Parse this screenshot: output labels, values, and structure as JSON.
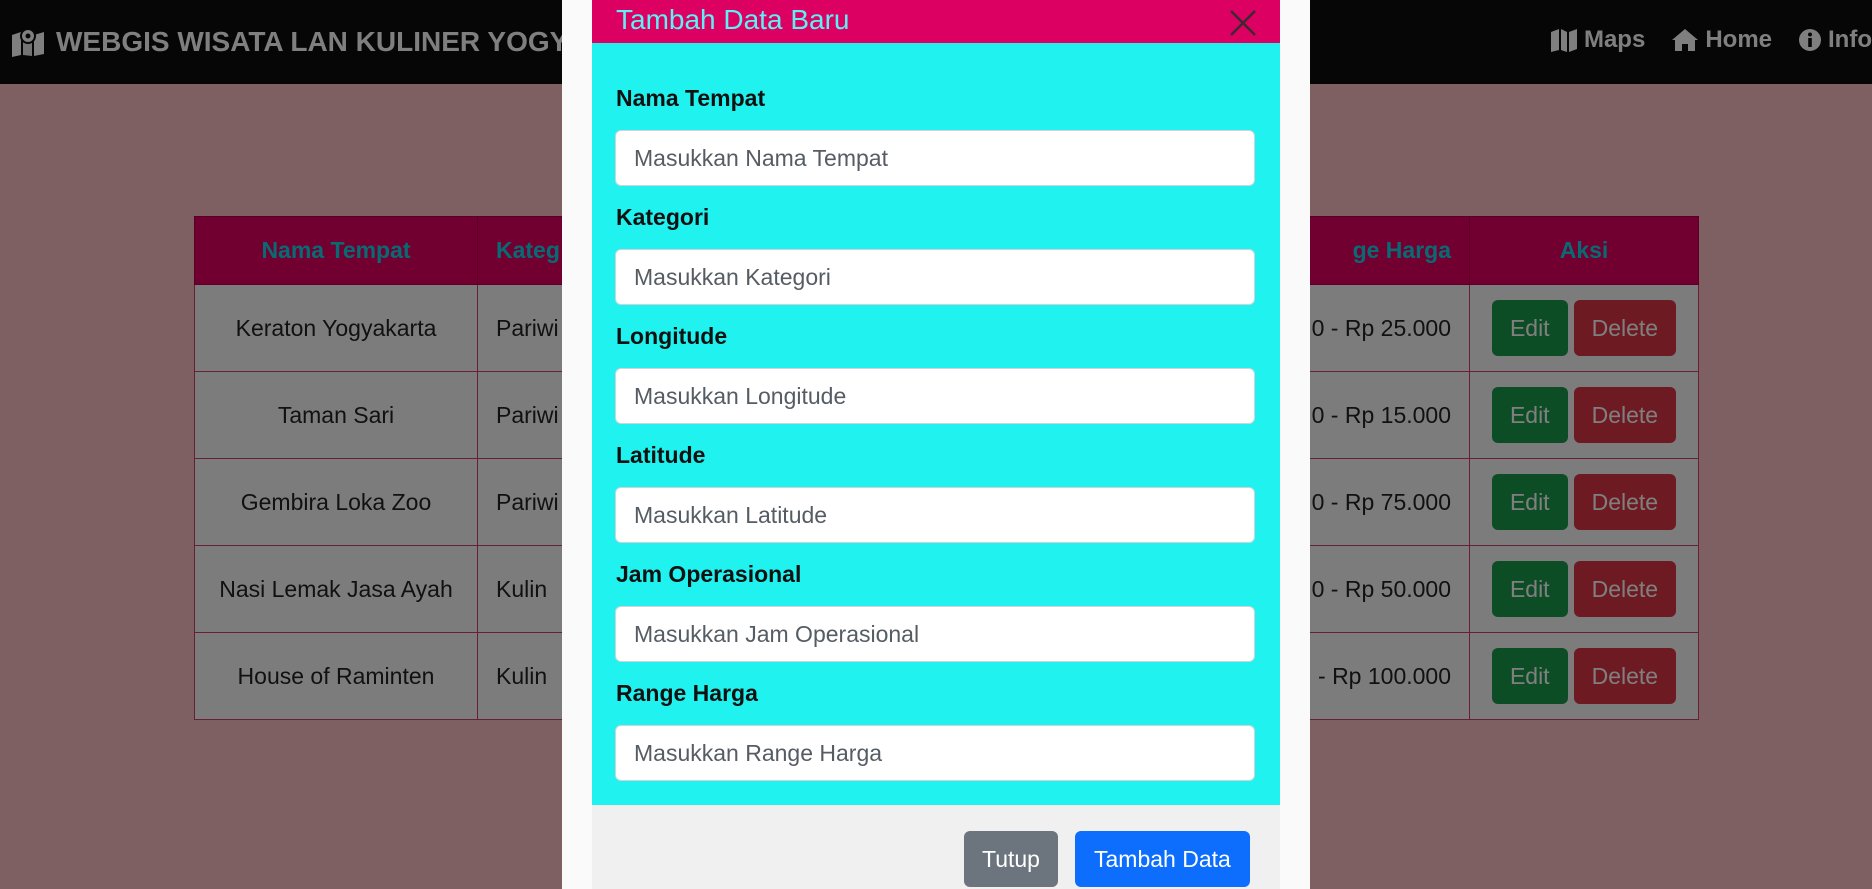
{
  "navbar": {
    "brand_icon": "map-location-icon",
    "brand": "WEBGIS WISATA LAN KULINER YOGYA",
    "links": [
      {
        "label": "Maps",
        "icon": "map-icon"
      },
      {
        "label": "Home",
        "icon": "home-icon"
      },
      {
        "label": "Info",
        "icon": "info-icon"
      }
    ]
  },
  "table": {
    "headers": [
      "Nama Tempat",
      "Kateg",
      "ge Harga",
      "Aksi"
    ],
    "rows": [
      {
        "nama": "Keraton Yogyakarta",
        "kategori": "Pariwi",
        "harga": "0 - Rp 25.000"
      },
      {
        "nama": "Taman Sari",
        "kategori": "Pariwi",
        "harga": "0 - Rp 15.000"
      },
      {
        "nama": "Gembira Loka Zoo",
        "kategori": "Pariwi",
        "harga": "0 - Rp 75.000"
      },
      {
        "nama": "Nasi Lemak Jasa Ayah",
        "kategori": "Kulin",
        "harga": "0 - Rp 50.000"
      },
      {
        "nama": "House of Raminten",
        "kategori": "Kulin",
        "harga": "- Rp 100.000"
      }
    ],
    "edit_label": "Edit",
    "delete_label": "Delete"
  },
  "modal": {
    "title": "Tambah Data Baru",
    "fields": [
      {
        "label": "Nama Tempat",
        "placeholder": "Masukkan Nama Tempat"
      },
      {
        "label": "Kategori",
        "placeholder": "Masukkan Kategori"
      },
      {
        "label": "Longitude",
        "placeholder": "Masukkan Longitude"
      },
      {
        "label": "Latitude",
        "placeholder": "Masukkan Latitude"
      },
      {
        "label": "Jam Operasional",
        "placeholder": "Masukkan Jam Operasional"
      },
      {
        "label": "Range Harga",
        "placeholder": "Masukkan Range Harga"
      }
    ],
    "close_label": "Tutup",
    "submit_label": "Tambah Data"
  },
  "colors": {
    "navbar": "#0d0d0d",
    "page_background": "#ffc0c4",
    "table_header": "#e20062",
    "table_header_text": "#11d6e6",
    "modal_header": "#dc0062",
    "modal_title": "#5ef0f5",
    "modal_body": "#20f2f0",
    "edit_button": "#1b9b4d",
    "delete_button": "#dc3545",
    "close_button": "#6c757d",
    "submit_button": "#0d6efd"
  }
}
